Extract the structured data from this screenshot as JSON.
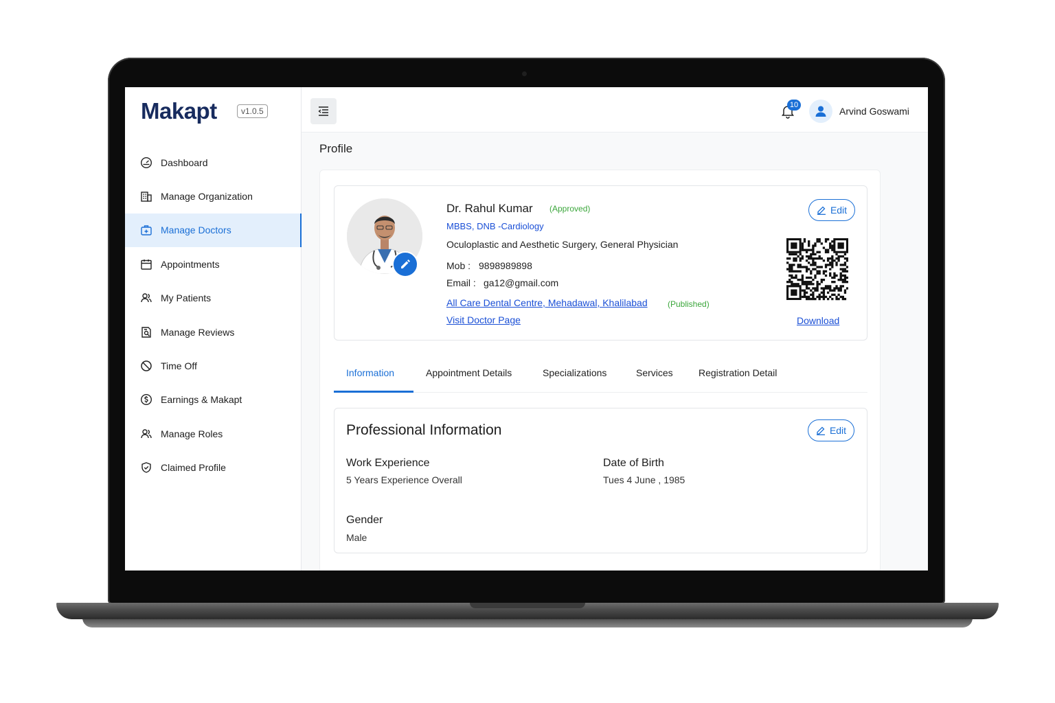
{
  "app": {
    "logo": "Makapt",
    "version": "v1.0.5"
  },
  "sidebar": {
    "items": [
      {
        "label": "Dashboard",
        "icon": "dashboard-gauge-icon"
      },
      {
        "label": "Manage Organization",
        "icon": "building-icon"
      },
      {
        "label": "Manage Doctors",
        "icon": "medical-briefcase-icon",
        "active": true
      },
      {
        "label": "Appointments",
        "icon": "calendar-icon"
      },
      {
        "label": "My Patients",
        "icon": "users-icon"
      },
      {
        "label": "Manage Reviews",
        "icon": "review-document-icon"
      },
      {
        "label": "Time Off",
        "icon": "ban-icon"
      },
      {
        "label": "Earnings & Makapt",
        "icon": "dollar-circle-icon"
      },
      {
        "label": "Manage Roles",
        "icon": "user-roles-icon"
      },
      {
        "label": "Claimed Profile",
        "icon": "shield-check-icon"
      }
    ]
  },
  "topbar": {
    "notification_count": "10",
    "user_name": "Arvind Goswami"
  },
  "page": {
    "title": "Profile"
  },
  "profile": {
    "name": "Dr. Rahul Kumar",
    "status": "(Approved)",
    "qualification": "MBBS, DNB -Cardiology",
    "speciality": "Oculoplastic and Aesthetic Surgery, General Physician",
    "mob_label": "Mob :",
    "mob": "9898989898",
    "email_label": "Email :",
    "email": "ga12@gmail.com",
    "clinic": "All Care Dental Centre, Mehadawal, Khalilabad",
    "clinic_status": "(Published)",
    "visit_link": "Visit Doctor Page",
    "edit_label": "Edit",
    "download_label": "Download"
  },
  "tabs": [
    {
      "label": "Information",
      "active": true
    },
    {
      "label": "Appointment Details"
    },
    {
      "label": "Specializations"
    },
    {
      "label": "Services"
    },
    {
      "label": "Registration Detail"
    }
  ],
  "professional_info": {
    "title": "Professional Information",
    "edit_label": "Edit",
    "fields": [
      {
        "label": "Work Experience",
        "value": "5 Years Experience Overall"
      },
      {
        "label": "Date of Birth",
        "value": "Tues 4 June , 1985"
      },
      {
        "label": "Gender",
        "value": "Male"
      }
    ]
  },
  "colors": {
    "accent": "#1a6fd6",
    "brand": "#172b5e",
    "success": "#3aa63a",
    "link": "#1a4fd6"
  }
}
